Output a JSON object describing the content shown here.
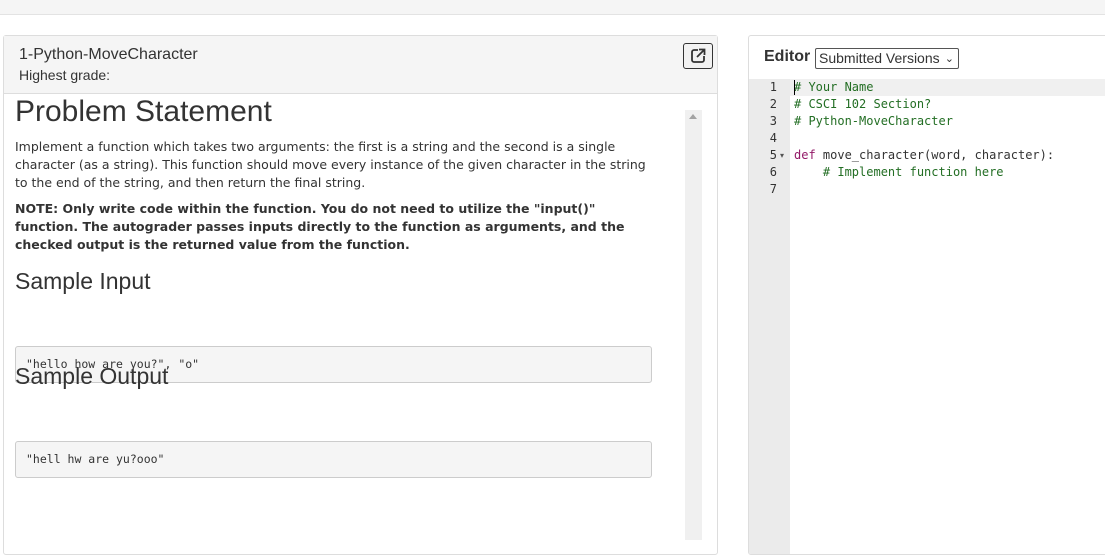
{
  "problem": {
    "title": "1-Python-MoveCharacter",
    "highest_grade_label": "Highest grade:",
    "heading": "Problem Statement",
    "description": "Implement a function which takes two arguments: the first is a string and the second is a single character (as a string). This function should move every instance of the given character in the string to the end of the string, and then return the final string.",
    "note": "NOTE: Only write code within the function. You do not need to utilize the \"input()\" function. The autograder passes inputs directly to the function as arguments, and the checked output is the returned value from the function.",
    "sample_input_heading": "Sample Input",
    "sample_input": "\"hello how are you?\", \"o\"",
    "sample_output_heading": "Sample Output",
    "sample_output": "\"hell hw are yu?ooo\""
  },
  "editor": {
    "label": "Editor",
    "version_select": "Submitted Versions",
    "lines": [
      {
        "num": "1",
        "text": "# Your Name"
      },
      {
        "num": "2",
        "text": "# CSCI 102 Section?"
      },
      {
        "num": "3",
        "text": "# Python-MoveCharacter"
      },
      {
        "num": "4",
        "text": ""
      },
      {
        "num": "5",
        "kw": "def",
        "text": " move_character(word, character):"
      },
      {
        "num": "6",
        "text": "    # Implement function here"
      },
      {
        "num": "7",
        "text": ""
      }
    ]
  },
  "icons": {
    "popout": "external-link-icon",
    "scroll_up": "arrow-up-icon",
    "fold": "fold-caret-icon",
    "select": "chevron-down-icon"
  },
  "colors": {
    "comment": "#236e24",
    "keyword": "#931a68",
    "gutter": "#ebebeb",
    "header_bg": "#f5f5f5"
  }
}
